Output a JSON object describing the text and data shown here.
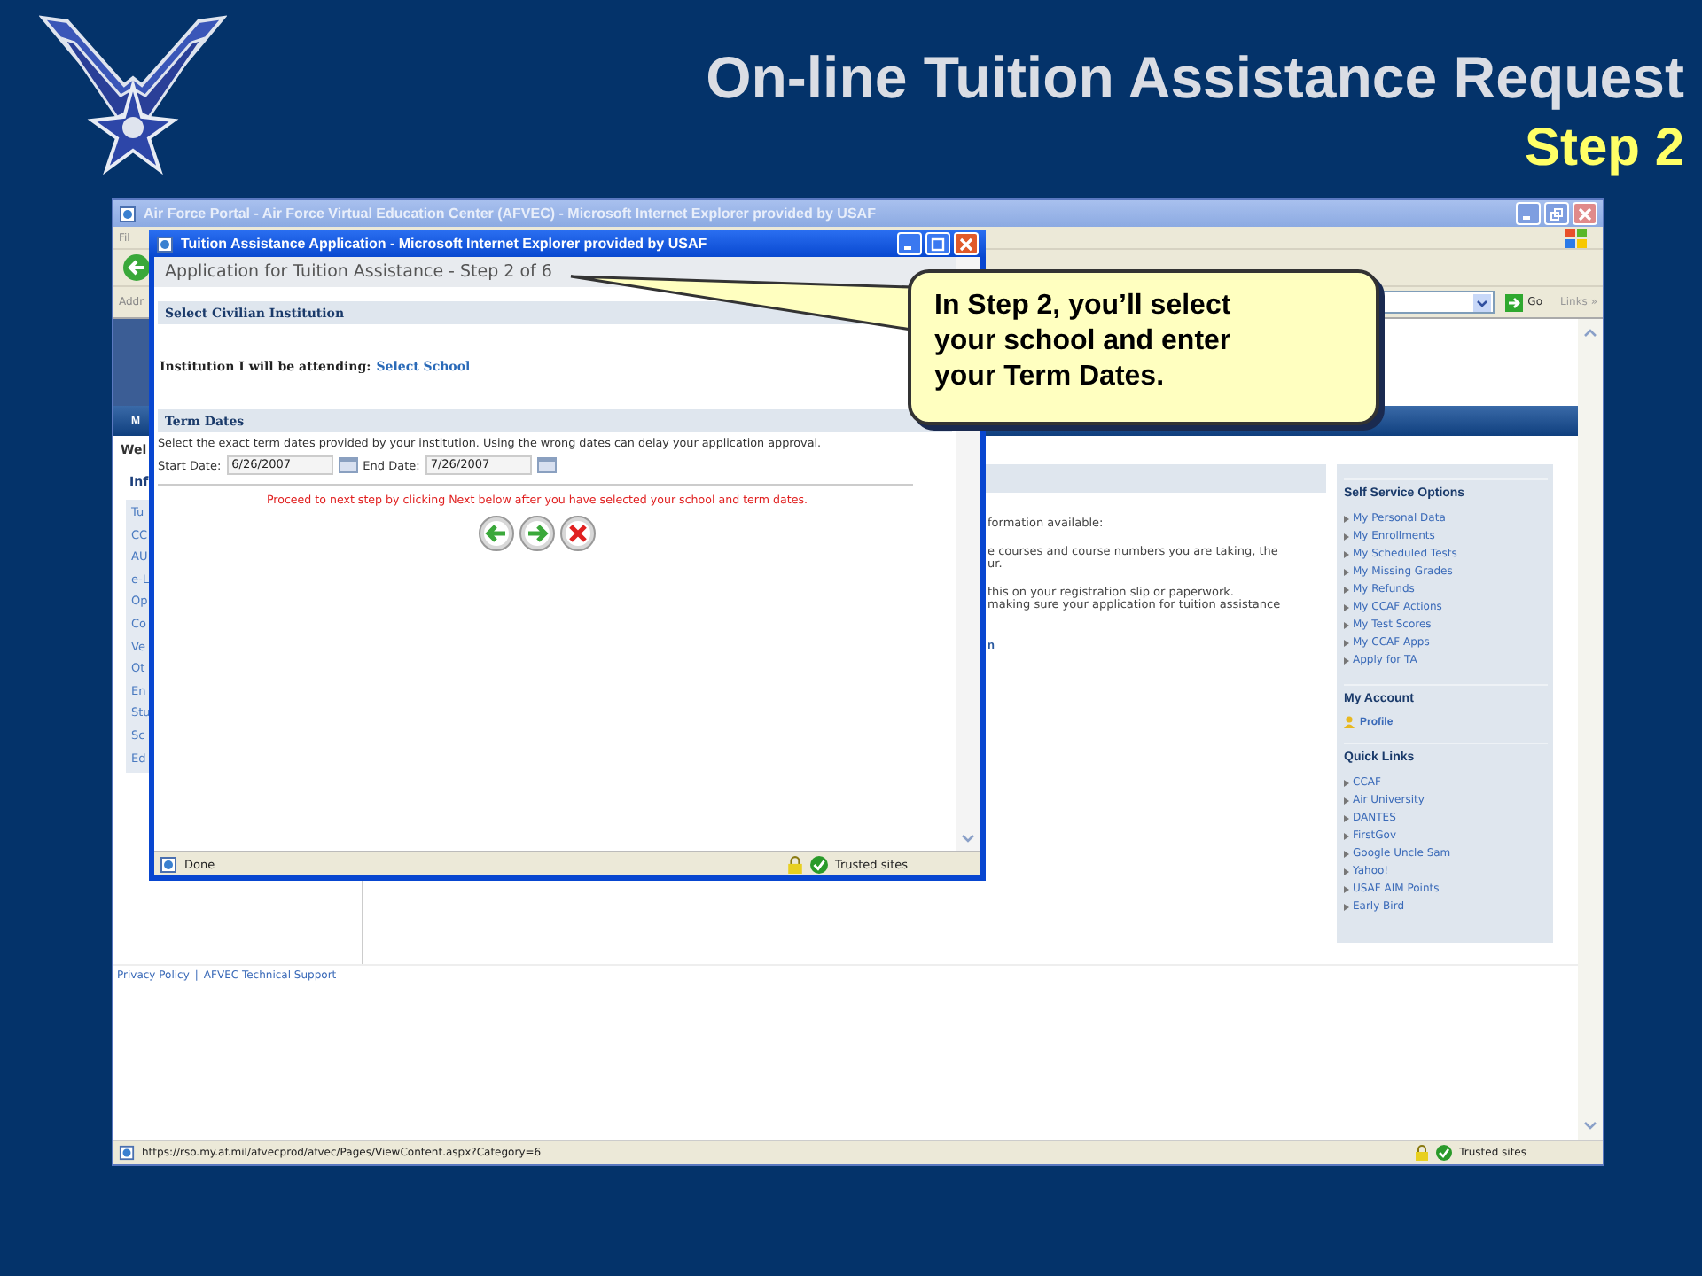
{
  "slide": {
    "title": "On-line Tuition Assistance Request",
    "subtitle": "Step 2"
  },
  "browser": {
    "title": "Air Force Portal - Air Force Virtual Education Center (AFVEC) - Microsoft Internet Explorer provided by USAF",
    "menu": "Fil",
    "address_label": "Addr",
    "go": "Go",
    "links": "Links »"
  },
  "page": {
    "nav_tab": "M",
    "welcome": "Wel",
    "info_heading": "Inf",
    "nav_items": [
      "Tu",
      "CC",
      "AU",
      "e-L",
      "Op",
      "Co",
      "Ve",
      "Ot",
      "En",
      "Stu",
      "Sc",
      "Ed"
    ],
    "main_lines": [
      {
        "kind": "text",
        "text": "formation available:"
      },
      {
        "kind": "text",
        "text": "e courses and course numbers you are taking, the"
      },
      {
        "kind": "text",
        "text": "ur."
      },
      {
        "kind": "text",
        "text": "this on your registration slip or paperwork."
      },
      {
        "kind": "text",
        "text": "making sure your application for tuition assistance"
      },
      {
        "kind": "link",
        "text": "n"
      }
    ],
    "sidebar": [
      {
        "title": "Self Service Options",
        "kind": "list",
        "items": [
          "My Personal Data",
          "My Enrollments",
          "My Scheduled Tests",
          "My Missing Grades",
          "My Refunds",
          "My CCAF Actions",
          "My Test Scores",
          "My CCAF Apps",
          "Apply for TA"
        ]
      },
      {
        "title": "My Account",
        "kind": "profile",
        "items": [
          "Profile"
        ]
      },
      {
        "title": "Quick Links",
        "kind": "list",
        "items": [
          "CCAF",
          "Air University",
          "DANTES",
          "FirstGov",
          "Google Uncle Sam",
          "Yahoo!",
          "USAF AIM Points",
          "Early Bird"
        ]
      }
    ],
    "footer_links": [
      "Privacy Policy",
      "AFVEC Technical Support"
    ],
    "footer_separator": "|"
  },
  "status_bar": {
    "url": "https://rso.my.af.mil/afvecprod/afvec/Pages/ViewContent.aspx?Category=6",
    "zone": "Trusted sites"
  },
  "popup": {
    "title": "Tuition Assistance Application - Microsoft Internet Explorer provided by USAF",
    "header": "Application for Tuition Assistance - Step 2 of 6",
    "institution": {
      "title": "Select Civilian Institution",
      "label": "Institution I will be attending:",
      "link": "Select School"
    },
    "term": {
      "title": "Term Dates",
      "description": "Select the exact term dates provided by your institution. Using the wrong dates can delay your application approval.",
      "start_label": "Start Date:",
      "start_value": "6/26/2007",
      "end_label": "End Date:",
      "end_value": "7/26/2007"
    },
    "instruction": "Proceed to next step by clicking Next below after you have selected your school and term dates.",
    "status": "Done",
    "zone": "Trusted sites"
  },
  "callout": {
    "text": "In Step 2, you’ll select your school and enter your Term Dates."
  }
}
